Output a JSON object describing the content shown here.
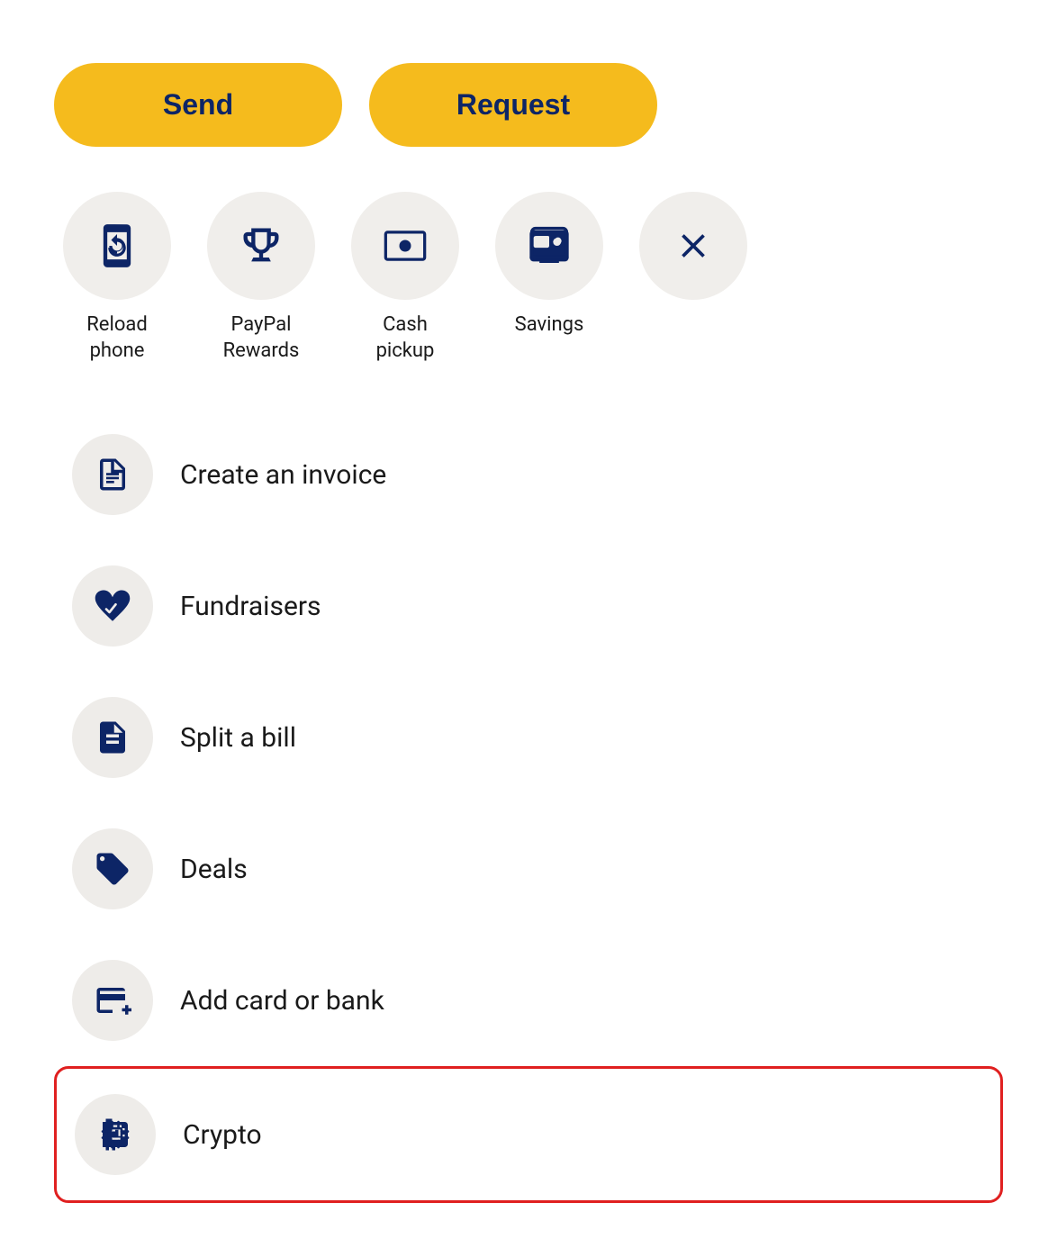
{
  "buttons": {
    "send_label": "Send",
    "request_label": "Request"
  },
  "quick_actions": [
    {
      "id": "reload-phone",
      "label": "Reload\nphone",
      "icon": "phone-reload"
    },
    {
      "id": "paypal-rewards",
      "label": "PayPal\nRewards",
      "icon": "trophy"
    },
    {
      "id": "cash-pickup",
      "label": "Cash\npickup",
      "icon": "cash-register"
    },
    {
      "id": "savings",
      "label": "Savings",
      "icon": "safe"
    },
    {
      "id": "close",
      "label": "",
      "icon": "close"
    }
  ],
  "list_items": [
    {
      "id": "create-invoice",
      "label": "Create an invoice",
      "icon": "invoice",
      "highlighted": false
    },
    {
      "id": "fundraisers",
      "label": "Fundraisers",
      "icon": "fundraisers",
      "highlighted": false
    },
    {
      "id": "split-bill",
      "label": "Split a bill",
      "icon": "split-bill",
      "highlighted": false
    },
    {
      "id": "deals",
      "label": "Deals",
      "icon": "deals",
      "highlighted": false
    },
    {
      "id": "add-card-bank",
      "label": "Add card or bank",
      "icon": "add-card",
      "highlighted": false
    },
    {
      "id": "crypto",
      "label": "Crypto",
      "icon": "crypto",
      "highlighted": true
    }
  ]
}
